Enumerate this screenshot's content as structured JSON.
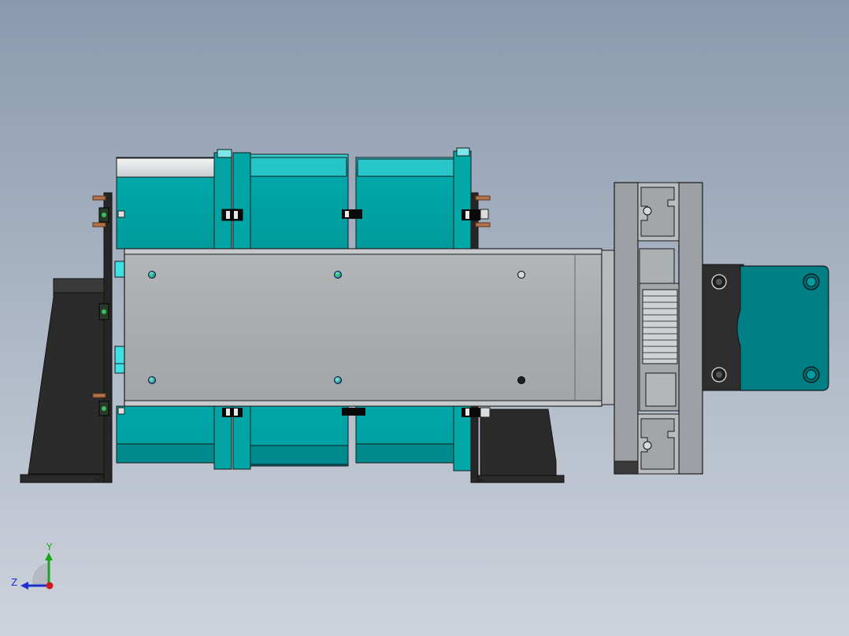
{
  "viewport": {
    "background_top": "#8a9aae",
    "background_bottom": "#ced3dc"
  },
  "colors": {
    "teal": "#00a4a4",
    "teal_dark": "#007f85",
    "teal_light": "#55e8ec",
    "steel": "#a8abad",
    "steel_dark": "#8f9294",
    "rail_gray": "#9c9fa3",
    "bracket_black": "#2b2b2b",
    "copper": "#b5734c",
    "outline": "#1a1a1a"
  },
  "triad": {
    "y_label": "Y",
    "z_label": "Z",
    "y_color": "#1aa51a",
    "z_color": "#2030d0",
    "x_color": "#d01818"
  }
}
